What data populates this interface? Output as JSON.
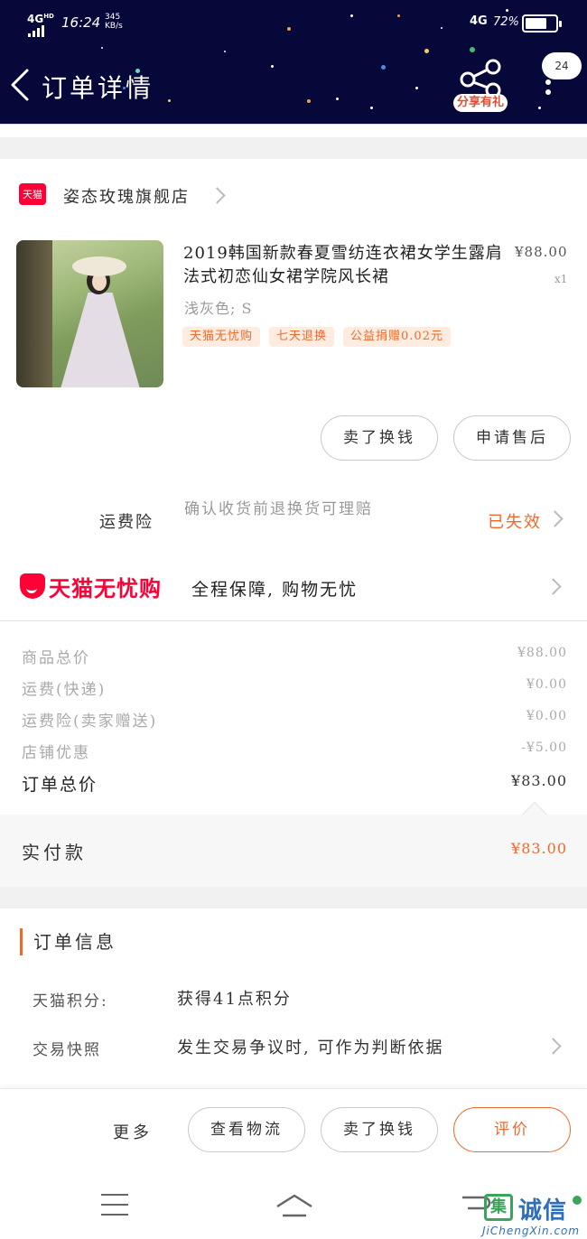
{
  "status_bar": {
    "network": "4G",
    "network_sup": "HD",
    "time": "16:24",
    "speed_value": "345",
    "speed_unit": "KB/s",
    "network_right": "4G",
    "battery": "72%",
    "battery_level": 0.72
  },
  "header": {
    "title": "订单详情",
    "share_label": "分享有礼",
    "message_count": "24"
  },
  "shop": {
    "logo_text": "天猫",
    "name": "姿态玫瑰旗舰店"
  },
  "product": {
    "title": "2019韩国新款春夏雪纺连衣裙女学生露肩法式初恋仙女裙学院风长裙",
    "price": "¥88.00",
    "quantity": "x1",
    "sku": "浅灰色; S",
    "tags": [
      "天猫无忧购",
      "七天退换",
      "公益捐赠0.02元"
    ]
  },
  "product_actions": {
    "sell_label": "卖了换钱",
    "after_sale_label": "申请售后"
  },
  "freight_insurance": {
    "label": "运费险",
    "description": "确认收货前退换货可理赔",
    "status": "已失效"
  },
  "guarantee": {
    "brand": "天猫无忧购",
    "text": "全程保障, 购物无忧"
  },
  "price_breakdown": [
    {
      "label": "商品总价",
      "value": "¥88.00"
    },
    {
      "label": "运费(快递)",
      "value": "¥0.00"
    },
    {
      "label": "运费险(卖家赠送)",
      "value": "¥0.00"
    },
    {
      "label": "店铺优惠",
      "value": "-¥5.00"
    }
  ],
  "order_total": {
    "label": "订单总价",
    "value": "¥83.00"
  },
  "paid": {
    "label": "实付款",
    "value": "¥83.00"
  },
  "order_info": {
    "title": "订单信息",
    "rows": [
      {
        "key": "天猫积分:",
        "value": "获得41点积分"
      },
      {
        "key": "交易快照",
        "value": "发生交易争议时, 可作为判断依据"
      }
    ]
  },
  "bottom_actions": {
    "more_label": "更多",
    "logistics_label": "查看物流",
    "sell_label": "卖了换钱",
    "review_label": "评价"
  },
  "watermark": {
    "box_char": "集",
    "chars": "诚信",
    "url": "JiChengXin.com"
  },
  "colors": {
    "header_bg": "#07083a",
    "accent_orange": "#ee6a2c",
    "tmall_red": "#ff0036",
    "tag_bg": "#fdecdf",
    "page_gray": "#f1f1f1"
  },
  "icons": [
    "back-icon",
    "share-icon",
    "more-icon",
    "tmall-logo-icon",
    "chevron-right-icon",
    "menu-icon",
    "home-icon",
    "back-nav-icon"
  ]
}
